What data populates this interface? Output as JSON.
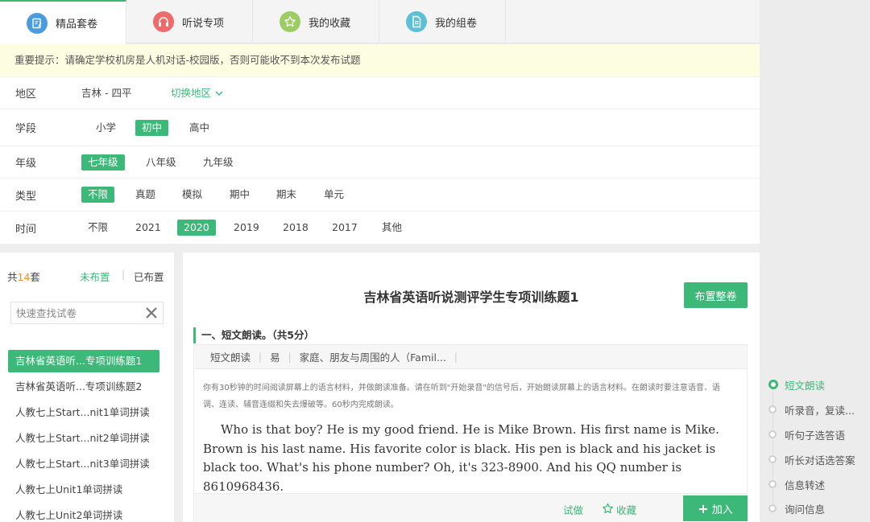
{
  "colors": {
    "accent": "#3cb878",
    "notice_bg": "#fdfde2",
    "count_number": "#f08d33"
  },
  "tabs": [
    {
      "label": "精品套卷",
      "icon": "paper-edit-icon",
      "color": "#4b9be0"
    },
    {
      "label": "听说专项",
      "icon": "headphones-icon",
      "color": "#ef6b6b"
    },
    {
      "label": "我的收藏",
      "icon": "star-icon",
      "color": "#9ccd63"
    },
    {
      "label": "我的组卷",
      "icon": "document-icon",
      "color": "#5ec0d6"
    }
  ],
  "notice": "重要提示：请确定学校机房是人机对话-校园版，否则可能收不到本次发布试题",
  "filters": {
    "region": {
      "label": "地区",
      "value": "吉林 - 四平",
      "switch": "切换地区"
    },
    "stage": {
      "label": "学段",
      "options": [
        "小学",
        "初中",
        "高中"
      ],
      "selected": "初中"
    },
    "grade": {
      "label": "年级",
      "options": [
        "七年级",
        "八年级",
        "九年级"
      ],
      "selected": "七年级"
    },
    "type": {
      "label": "类型",
      "options": [
        "不限",
        "真题",
        "模拟",
        "期中",
        "期末",
        "单元"
      ],
      "selected": "不限"
    },
    "time": {
      "label": "时间",
      "options": [
        "不限",
        "2021",
        "2020",
        "2019",
        "2018",
        "2017",
        "其他"
      ],
      "selected": "2020"
    }
  },
  "list": {
    "count_prefix": "共",
    "count": "14",
    "count_suffix": "套",
    "toggle_unassigned": "未布置",
    "toggle_assigned": "已布置",
    "search_placeholder": "快速查找试卷",
    "items": [
      "吉林省英语听...专项训练题1",
      "吉林省英语听...专项训练题2",
      "人教七上Start...nit1单词拼读",
      "人教七上Start...nit2单词拼读",
      "人教七上Start...nit3单词拼读",
      "人教七上Unit1单词拼读",
      "人教七上Unit2单词拼读"
    ],
    "selected_index": 0
  },
  "paper": {
    "title": "吉林省英语听说测评学生专项训练题1",
    "assign_button": "布置整卷",
    "section_title": "一、短文朗读。（共5分）",
    "tags": [
      "短文朗读",
      "易",
      "家庭、朋友与周围的人（Famil..."
    ],
    "instruction": "你有30秒钟的时间阅读屏幕上的语言材料，并做朗读准备。请在听到\"开始录音\"的信号后，开始朗读屏幕上的语言材料。在朗读时要注意语音、语调、连读、辅音连缀和失去爆破等。60秒内完成朗读。",
    "passage": "Who is that boy? He is my good friend. He is Mike Brown. His first name is Mike. Brown is his last name. His favorite color is black. His pen is black and his jacket is black too. What's his phone number? Oh, it's 323-8900. And his QQ number is 8610968436.",
    "try_label": "试做",
    "fav_label": "收藏",
    "add_label": "加入"
  },
  "outline": {
    "items": [
      "短文朗读",
      "听录音，复读...",
      "听句子选答语",
      "听长对话选答案",
      "信息转述",
      "询问信息"
    ],
    "active_index": 0
  }
}
